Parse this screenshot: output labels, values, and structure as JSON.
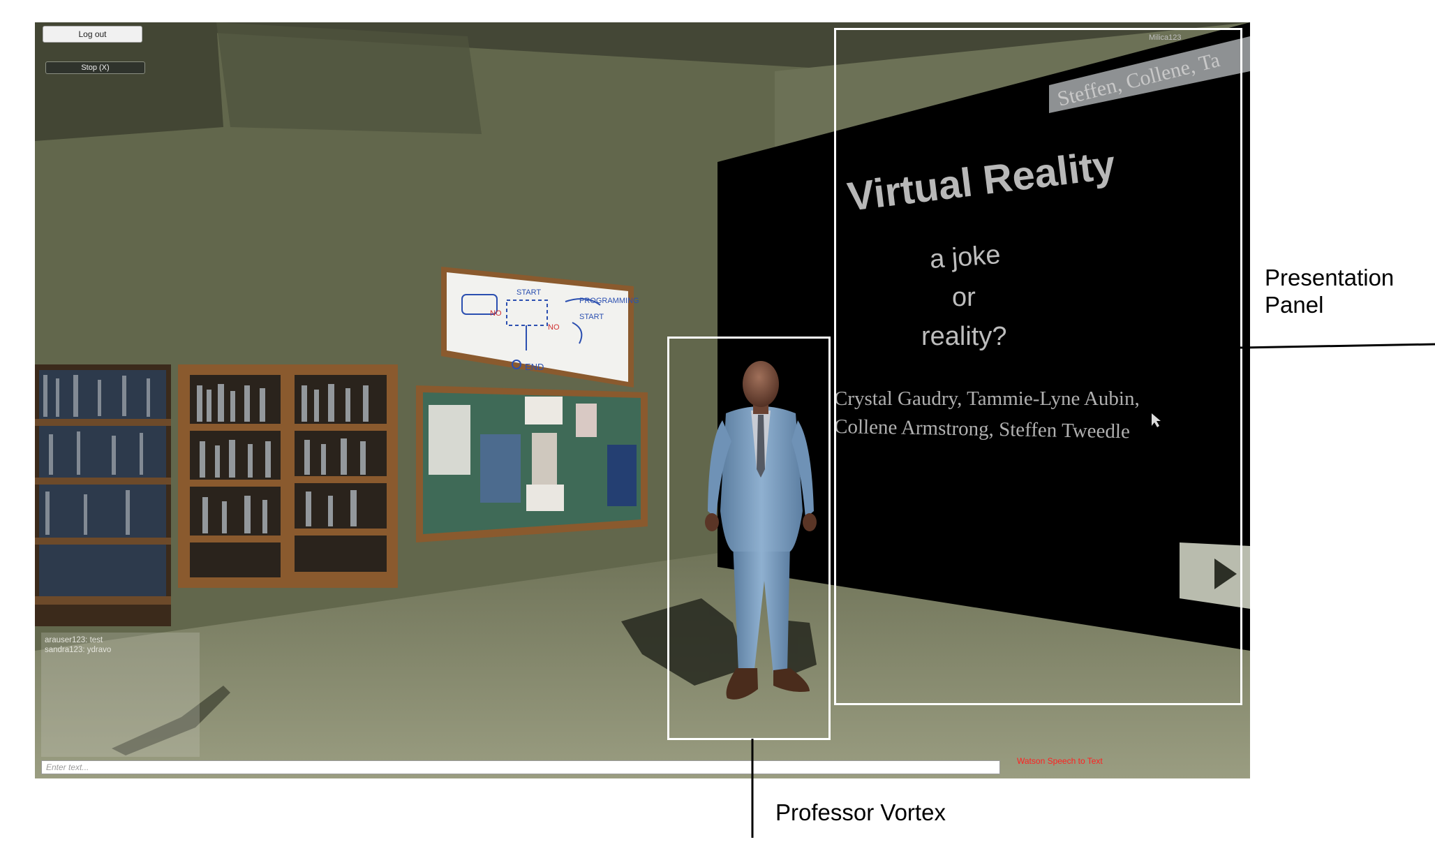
{
  "hud": {
    "logout_label": "Log out",
    "stop_label": "Stop (X)",
    "username": "Milica123",
    "chat_messages": [
      "arauser123: test",
      "sandra123: ydravo"
    ],
    "chat_placeholder": "Enter text...",
    "watson_label": "Watson Speech to Text"
  },
  "slide": {
    "title": "Virtual Reality",
    "subtitle_lines": [
      "a joke",
      "or",
      "reality?"
    ],
    "author_lines": [
      "Crystal Gaudry, Tammie-Lyne Aubin,",
      "Collene Armstrong, Steffen Tweedle"
    ],
    "banner_text": "Steffen, Collene, Ta"
  },
  "whiteboard": {
    "texts": [
      "START",
      "PROGRAMMING",
      "START",
      "NO",
      "NO",
      "END"
    ]
  },
  "callouts": {
    "presentation_label_line1": "Presentation",
    "presentation_label_line2": "Panel",
    "professor_label": "Professor Vortex"
  },
  "colors": {
    "wall": "#666b50",
    "floor": "#878a6e",
    "screen": "#000000",
    "suit": "#7ea0c2",
    "watson_label": "#ff2020",
    "callout_outline": "#ffffff"
  }
}
